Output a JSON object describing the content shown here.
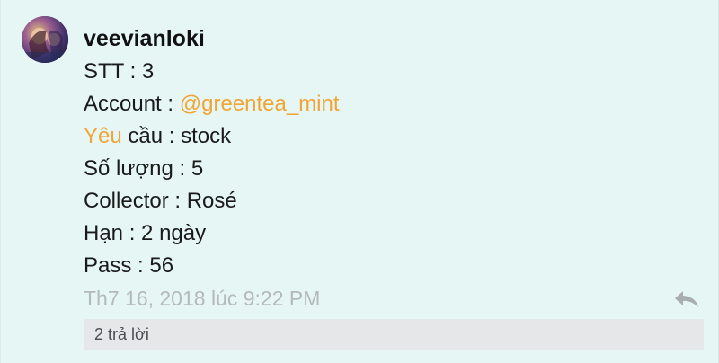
{
  "comment": {
    "username": "veevianloki",
    "avatar_icon": "user-avatar",
    "lines": [
      {
        "label": "STT",
        "sep": " : ",
        "value": "3"
      },
      {
        "label": "Account",
        "sep": " : ",
        "value": "@greentea_mint"
      },
      {
        "label_accent": "Yêu",
        "label_rest": " cầu",
        "sep": " : ",
        "value": "stock"
      },
      {
        "label": "Số lượng",
        "sep": " : ",
        "value": "5"
      },
      {
        "label": "Collector",
        "sep": " : ",
        "value": "Rosé"
      },
      {
        "label": "Hạn",
        "sep": " : ",
        "value": "2 ngày"
      },
      {
        "label": "Pass",
        "sep": " : ",
        "value": "56"
      }
    ],
    "timestamp": "Th7 16, 2018 lúc 9:22 PM",
    "reply_icon": "reply-arrow-icon",
    "replies_label": "2 trả lời"
  },
  "colors": {
    "background": "#e6f6f5",
    "accent": "#f0a534",
    "timestamp": "#b4b9bb",
    "replies_bar": "#e6e7e8"
  }
}
